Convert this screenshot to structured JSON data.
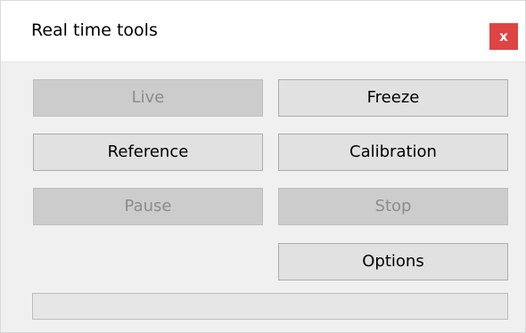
{
  "window": {
    "title": "Real time tools",
    "close_label": "x"
  },
  "buttons": {
    "live": {
      "label": "Live",
      "enabled": false
    },
    "freeze": {
      "label": "Freeze",
      "enabled": true
    },
    "reference": {
      "label": "Reference",
      "enabled": true
    },
    "calibration": {
      "label": "Calibration",
      "enabled": true
    },
    "pause": {
      "label": "Pause",
      "enabled": false
    },
    "stop": {
      "label": "Stop",
      "enabled": false
    },
    "options": {
      "label": "Options",
      "enabled": true
    }
  },
  "progress": {
    "value_percent": 0
  },
  "colors": {
    "close_button": "#e04343",
    "button_enabled": "#e1e1e1",
    "button_disabled": "#cccccc",
    "disabled_text": "#8c8c8c"
  }
}
